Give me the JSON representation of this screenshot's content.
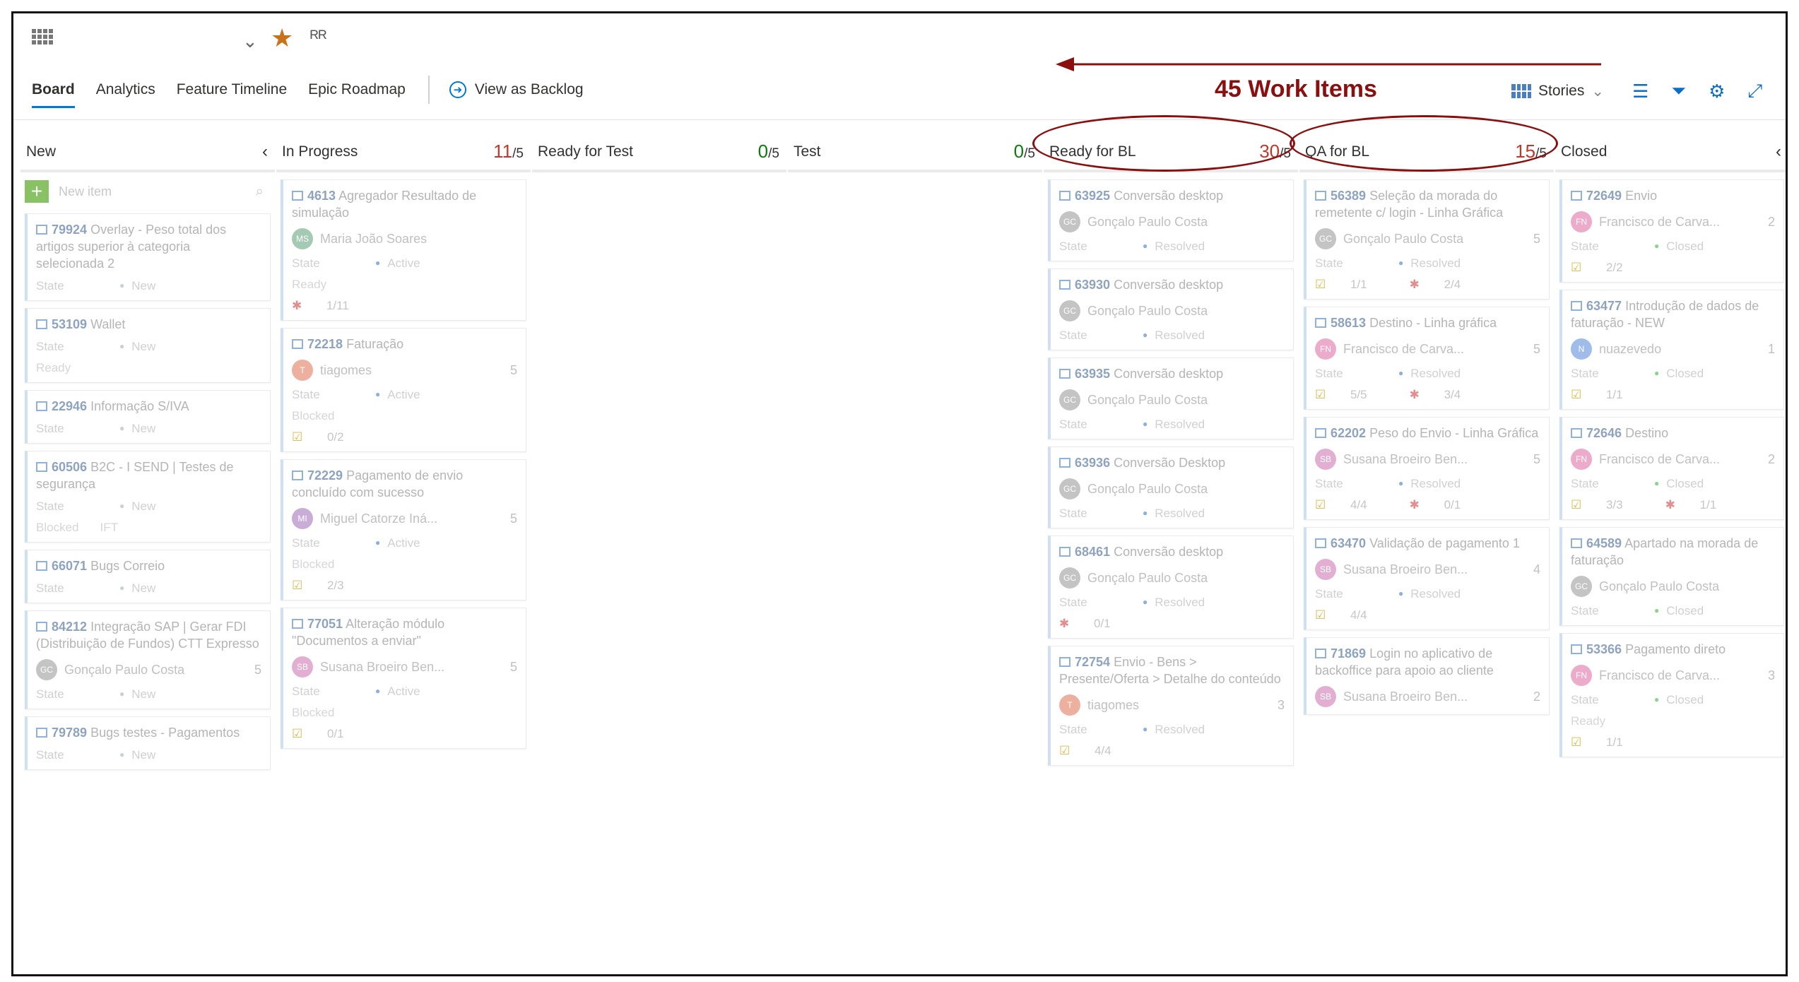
{
  "header": {
    "tabs": [
      {
        "label": "Board",
        "active": true
      },
      {
        "label": "Analytics"
      },
      {
        "label": "Feature Timeline"
      },
      {
        "label": "Epic Roadmap"
      }
    ],
    "view_as_backlog": "View as Backlog",
    "annotation": "45 Work Items",
    "backlog_level": "Stories",
    "icons": [
      "board-grid-icon",
      "chevron-down-icon",
      "favorite-star-icon",
      "team-members-icon",
      "view-options-icon",
      "filter-icon",
      "settings-gear-icon",
      "fullscreen-icon"
    ]
  },
  "colors": {
    "accent": "#0078d4",
    "annotation": "#8b0f0f",
    "over_limit": "#c0392b",
    "under_limit": "#107c10",
    "favorite": "#c8731c"
  },
  "columns": [
    {
      "name": "New",
      "count": "",
      "limit": "",
      "collapsible": true,
      "new_item": "New item",
      "cards": [
        {
          "id": "79924",
          "title": "Overlay - Peso total dos artigos superior à categoria selecionada 2",
          "state": "New",
          "state_label": "State"
        },
        {
          "id": "53109",
          "title": "Wallet",
          "state": "New",
          "state_label": "State",
          "tags": [
            "Ready"
          ]
        },
        {
          "id": "22946",
          "title": "Informação S/IVA",
          "state": "New",
          "state_label": "State"
        },
        {
          "id": "60506",
          "title": "B2C - I SEND | Testes de segurança",
          "state": "New",
          "state_label": "State",
          "tags": [
            "Blocked",
            "IFT"
          ]
        },
        {
          "id": "66071",
          "title": "Bugs Correio",
          "state": "New",
          "state_label": "State"
        },
        {
          "id": "84212",
          "title": "Integração SAP | Gerar FDI (Distribuição de Fundos) CTT Expresso",
          "owner": "Gonçalo Paulo Costa",
          "initials": "GC",
          "points": "5",
          "state": "New",
          "state_label": "State"
        },
        {
          "id": "79789",
          "title": "Bugs testes - Pagamentos",
          "state": "New",
          "state_label": "State"
        }
      ]
    },
    {
      "name": "In Progress",
      "count": "11",
      "limit": "/5",
      "cards": [
        {
          "id": "4613",
          "title": "Agregador Resultado de simulação",
          "owner": "Maria João Soares",
          "initials": "MS",
          "state": "Active",
          "state_label": "State",
          "tags": [
            "Ready"
          ],
          "bugs": "1/11"
        },
        {
          "id": "72218",
          "title": "Faturação",
          "owner": "tiagomes",
          "initials": "T",
          "points": "5",
          "state": "Active",
          "state_label": "State",
          "tags": [
            "Blocked"
          ],
          "tasks": "0/2"
        },
        {
          "id": "72229",
          "title": "Pagamento de envio concluído com sucesso",
          "owner": "Miguel Catorze Iná...",
          "initials": "MI",
          "points": "5",
          "state": "Active",
          "state_label": "State",
          "tags": [
            "Blocked"
          ],
          "tasks": "2/3"
        },
        {
          "id": "77051",
          "title": "Alteração módulo \"Documentos a enviar\"",
          "owner": "Susana Broeiro Ben...",
          "initials": "SB",
          "points": "5",
          "state": "Active",
          "state_label": "State",
          "tags": [
            "Blocked"
          ],
          "tasks": "0/1"
        }
      ]
    },
    {
      "name": "Ready for Test",
      "count": "0",
      "limit": "/5",
      "cards": []
    },
    {
      "name": "Test",
      "count": "0",
      "limit": "/5",
      "cards": []
    },
    {
      "name": "Ready for BL",
      "count": "30",
      "limit": "/5",
      "cards": [
        {
          "id": "63925",
          "title": "Conversão desktop",
          "owner": "Gonçalo Paulo Costa",
          "initials": "GC",
          "state": "Resolved",
          "state_label": "State"
        },
        {
          "id": "63930",
          "title": "Conversão desktop",
          "owner": "Gonçalo Paulo Costa",
          "initials": "GC",
          "state": "Resolved",
          "state_label": "State"
        },
        {
          "id": "63935",
          "title": "Conversão desktop",
          "owner": "Gonçalo Paulo Costa",
          "initials": "GC",
          "state": "Resolved",
          "state_label": "State"
        },
        {
          "id": "63936",
          "title": "Conversão Desktop",
          "owner": "Gonçalo Paulo Costa",
          "initials": "GC",
          "state": "Resolved",
          "state_label": "State"
        },
        {
          "id": "68461",
          "title": "Conversão desktop",
          "owner": "Gonçalo Paulo Costa",
          "initials": "GC",
          "state": "Resolved",
          "state_label": "State",
          "bugs": "0/1"
        },
        {
          "id": "72754",
          "title": "Envio - Bens > Presente/Oferta > Detalhe do conteúdo",
          "owner": "tiagomes",
          "initials": "T",
          "points": "3",
          "state": "Resolved",
          "state_label": "State",
          "tasks": "4/4"
        }
      ]
    },
    {
      "name": "QA for BL",
      "count": "15",
      "limit": "/5",
      "cards": [
        {
          "id": "56389",
          "title": "Seleção da morada do remetente c/ login - Linha Gráfica",
          "owner": "Gonçalo Paulo Costa",
          "initials": "GC",
          "points": "5",
          "state": "Resolved",
          "state_label": "State",
          "tasks": "1/1",
          "bugs": "2/4"
        },
        {
          "id": "58613",
          "title": "Destino - Linha gráfica",
          "owner": "Francisco de Carva...",
          "initials": "FN",
          "points": "5",
          "state": "Resolved",
          "state_label": "State",
          "tasks": "5/5",
          "bugs": "3/4"
        },
        {
          "id": "62202",
          "title": "Peso do Envio - Linha Gráfica",
          "owner": "Susana Broeiro Ben...",
          "initials": "SB",
          "points": "5",
          "state": "Resolved",
          "state_label": "State",
          "tasks": "4/4",
          "bugs": "0/1"
        },
        {
          "id": "63470",
          "title": "Validação de pagamento 1",
          "owner": "Susana Broeiro Ben...",
          "initials": "SB",
          "points": "4",
          "state": "Resolved",
          "state_label": "State",
          "tasks": "4/4"
        },
        {
          "id": "71869",
          "title": "Login no aplicativo de backoffice para apoio ao cliente",
          "owner": "Susana Broeiro Ben...",
          "initials": "SB",
          "points": "2"
        }
      ]
    },
    {
      "name": "Closed",
      "count": "",
      "limit": "",
      "collapsible": true,
      "cards": [
        {
          "id": "72649",
          "title": "Envio",
          "owner": "Francisco de Carva...",
          "initials": "FN",
          "points": "2",
          "state": "Closed",
          "state_label": "State",
          "tasks": "2/2"
        },
        {
          "id": "63477",
          "title": "Introdução de dados de faturação - NEW",
          "owner": "nuazevedo",
          "initials": "N",
          "points": "1",
          "state": "Closed",
          "state_label": "State",
          "tasks": "1/1"
        },
        {
          "id": "72646",
          "title": "Destino",
          "owner": "Francisco de Carva...",
          "initials": "FN",
          "points": "2",
          "state": "Closed",
          "state_label": "State",
          "tasks": "3/3",
          "bugs": "1/1"
        },
        {
          "id": "64589",
          "title": "Apartado na morada de faturação",
          "owner": "Gonçalo Paulo Costa",
          "initials": "GC",
          "state": "Closed",
          "state_label": "State"
        },
        {
          "id": "53366",
          "title": "Pagamento direto",
          "owner": "Francisco de Carva...",
          "initials": "FN",
          "points": "3",
          "state": "Closed",
          "state_label": "State",
          "tags": [
            "Ready"
          ],
          "tasks": "1/1"
        }
      ]
    }
  ]
}
